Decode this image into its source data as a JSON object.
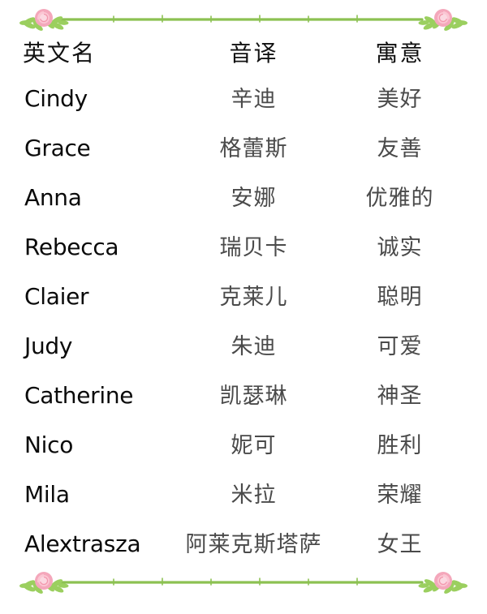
{
  "decor": {
    "top_border_name": "rose-vine-divider-top",
    "bottom_border_name": "rose-vine-divider-bottom",
    "rose_color": "#f4a7bb",
    "rose_center_color": "#fbd3dd",
    "vine_color": "#8cc152",
    "leaf_color": "#9bcf5f"
  },
  "table": {
    "headers": {
      "name": "英文名",
      "translit": "音译",
      "meaning": "寓意"
    },
    "rows": [
      {
        "name": "Cindy",
        "translit": "辛迪",
        "meaning": "美好"
      },
      {
        "name": "Grace",
        "translit": "格蕾斯",
        "meaning": "友善"
      },
      {
        "name": "Anna",
        "translit": "安娜",
        "meaning": "优雅的"
      },
      {
        "name": "Rebecca",
        "translit": "瑞贝卡",
        "meaning": "诚实"
      },
      {
        "name": "Claier",
        "translit": "克莱儿",
        "meaning": "聪明"
      },
      {
        "name": "Judy",
        "translit": "朱迪",
        "meaning": "可爱"
      },
      {
        "name": "Catherine",
        "translit": "凯瑟琳",
        "meaning": "神圣"
      },
      {
        "name": "Nico",
        "translit": "妮可",
        "meaning": "胜利"
      },
      {
        "name": "Mila",
        "translit": "米拉",
        "meaning": "荣耀"
      },
      {
        "name": "Alextrasza",
        "translit": "阿莱克斯塔萨",
        "meaning": "女王"
      }
    ]
  }
}
